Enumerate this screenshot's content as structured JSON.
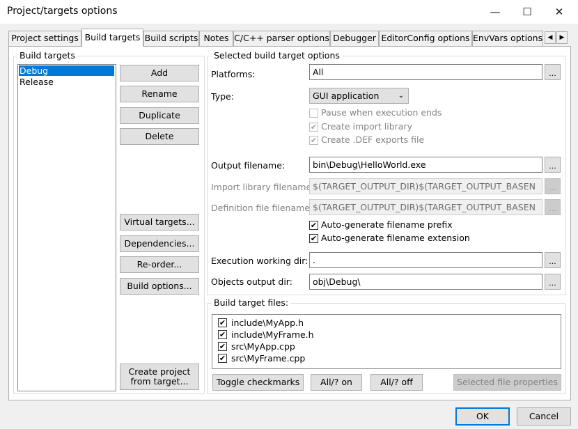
{
  "window": {
    "title": "Project/targets options",
    "minimize_glyph": "—",
    "maximize_glyph": "☐",
    "close_glyph": "✕"
  },
  "tabs": [
    {
      "label": "Project settings",
      "active": false
    },
    {
      "label": "Build targets",
      "active": true
    },
    {
      "label": "Build scripts",
      "active": false
    },
    {
      "label": "Notes",
      "active": false
    },
    {
      "label": "C/C++ parser options",
      "active": false
    },
    {
      "label": "Debugger",
      "active": false
    },
    {
      "label": "EditorConfig options",
      "active": false
    },
    {
      "label": "EnvVars options",
      "active": false
    }
  ],
  "tab_scroll": {
    "left": "◀",
    "right": "▶"
  },
  "build_targets": {
    "group_label": "Build targets",
    "items": [
      {
        "label": "Debug",
        "selected": true
      },
      {
        "label": "Release",
        "selected": false
      }
    ],
    "buttons": {
      "add": "Add",
      "rename": "Rename",
      "duplicate": "Duplicate",
      "delete": "Delete",
      "virtual_targets": "Virtual targets...",
      "dependencies": "Dependencies...",
      "reorder": "Re-order...",
      "build_options": "Build options...",
      "create_project": "Create project from target..."
    }
  },
  "selected_target": {
    "group_label": "Selected build target options",
    "platforms_label": "Platforms:",
    "platforms_value": "All",
    "type_label": "Type:",
    "type_value": "GUI application",
    "pause_label": "Pause when execution ends",
    "create_import_label": "Create import library",
    "create_def_label": "Create .DEF exports file",
    "output_label": "Output filename:",
    "output_value": "bin\\Debug\\HelloWorld.exe",
    "import_label": "Import library filename:",
    "import_value": "$(TARGET_OUTPUT_DIR)$(TARGET_OUTPUT_BASEN",
    "def_label": "Definition file filename:",
    "def_value": "$(TARGET_OUTPUT_DIR)$(TARGET_OUTPUT_BASEN",
    "auto_prefix_label": "Auto-generate filename prefix",
    "auto_ext_label": "Auto-generate filename extension",
    "exec_dir_label": "Execution working dir:",
    "exec_dir_value": ".",
    "obj_dir_label": "Objects output dir:",
    "obj_dir_value": "obj\\Debug\\",
    "browse_label": "..."
  },
  "target_files": {
    "group_label": "Build target files:",
    "files": [
      {
        "name": "include\\MyApp.h",
        "checked": true
      },
      {
        "name": "include\\MyFrame.h",
        "checked": true
      },
      {
        "name": "src\\MyApp.cpp",
        "checked": true
      },
      {
        "name": "src\\MyFrame.cpp",
        "checked": true
      }
    ],
    "buttons": {
      "toggle": "Toggle checkmarks",
      "all_on": "All/? on",
      "all_off": "All/? off",
      "properties": "Selected file properties"
    }
  },
  "footer": {
    "ok": "OK",
    "cancel": "Cancel"
  },
  "check_glyph": "✔"
}
